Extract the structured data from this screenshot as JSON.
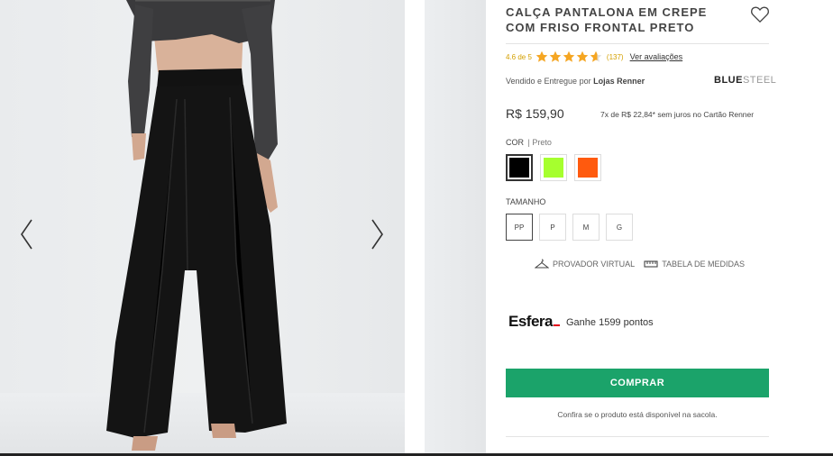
{
  "product": {
    "title": "CALÇA PANTALONA EM CREPE COM FRISO FRONTAL PRETO",
    "rating_score": "4.6 de 5",
    "rating_value": 4.6,
    "rating_max": 5,
    "rating_count": "(137)",
    "rating_link": "Ver avaliações",
    "seller_prefix": "Vendido e Entregue por ",
    "seller_name": "Lojas Renner",
    "brand_bold": "BLUE",
    "brand_light": "STEEL",
    "price": "R$ 159,90",
    "installments": "7x de R$ 22,84* sem juros no Cartão Renner"
  },
  "color": {
    "label": "COR",
    "selected_value": "Preto",
    "swatches": [
      {
        "name": "Preto",
        "hex": "#000000",
        "selected": true
      },
      {
        "name": "Verde",
        "hex": "#a6ff2e",
        "selected": false
      },
      {
        "name": "Laranja",
        "hex": "#ff5a0e",
        "selected": false
      }
    ]
  },
  "size": {
    "label": "TAMANHO",
    "options": [
      "PP",
      "P",
      "M",
      "G"
    ],
    "selected": "PP"
  },
  "links": {
    "virtual_fitting": "PROVADOR VIRTUAL",
    "size_chart": "TABELA DE MEDIDAS"
  },
  "esfera": {
    "logo": "Esfera",
    "points_text": "Ganhe 1599 pontos"
  },
  "cta": {
    "buy_label": "COMPRAR",
    "availability_note": "Confira se o produto está disponível na sacola."
  },
  "colors": {
    "buy_button": "#1ba36a",
    "star": "#f5a623"
  },
  "icons": {
    "prev": "chevron-left-icon",
    "next": "chevron-right-icon",
    "wishlist": "heart-icon",
    "hanger": "hanger-icon",
    "ruler": "ruler-icon"
  }
}
